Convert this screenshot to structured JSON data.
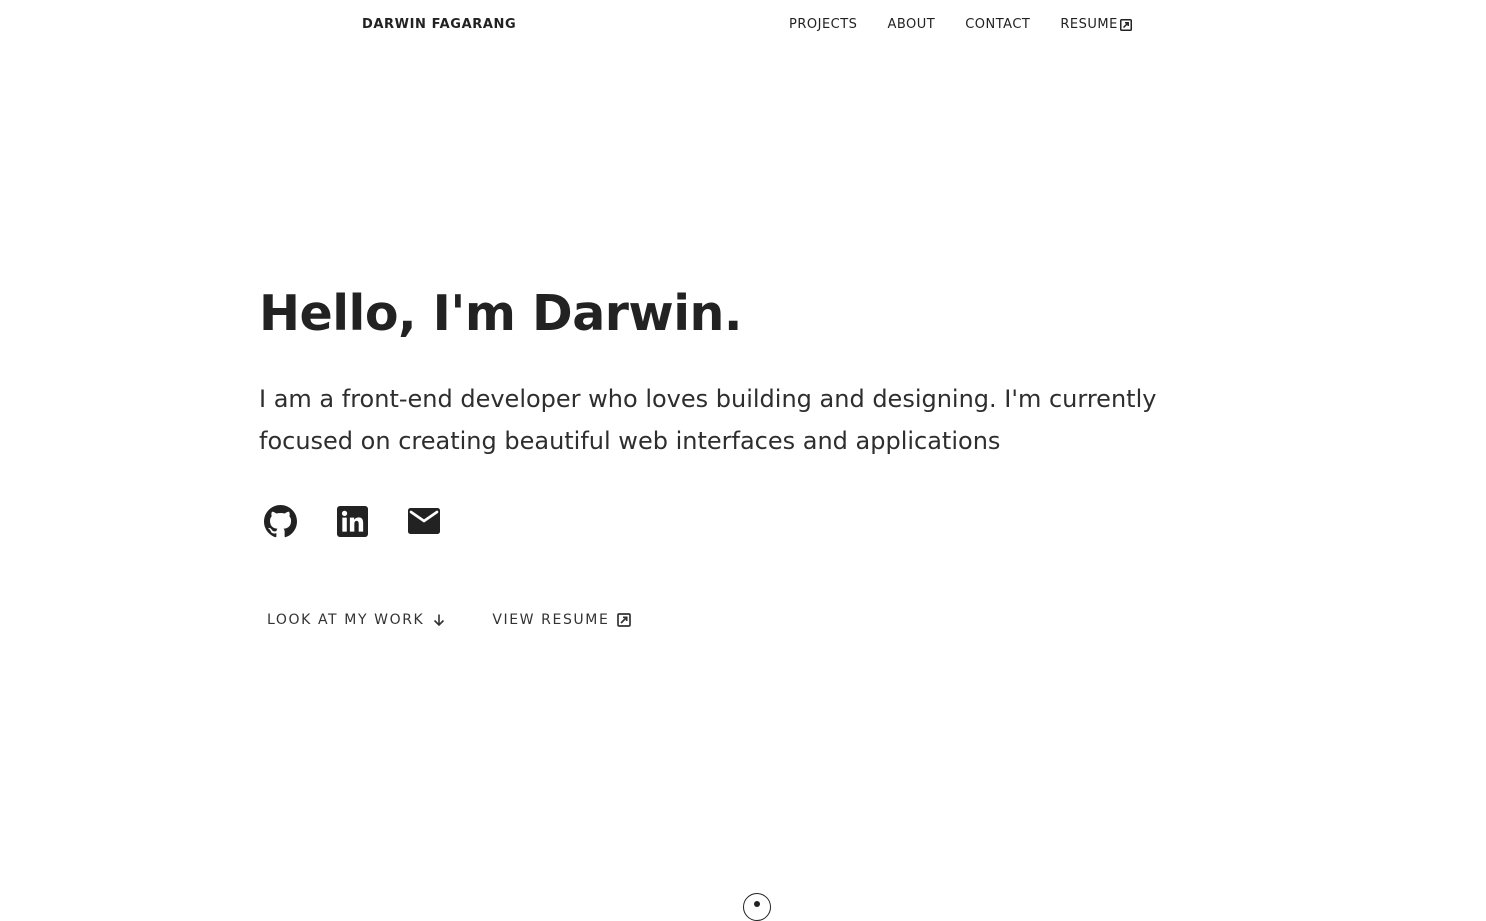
{
  "nav": {
    "brand": "DARWIN FAGARANG",
    "links": [
      {
        "label": "PROJECTS"
      },
      {
        "label": "ABOUT"
      },
      {
        "label": "CONTACT"
      },
      {
        "label": "RESUME"
      }
    ]
  },
  "hero": {
    "title": "Hello, I'm Darwin.",
    "description": "I am a front-end developer who loves building and designing. I'm currently focused on creating beautiful web interfaces and applications"
  },
  "socials": [
    {
      "icon": "github-icon"
    },
    {
      "icon": "linkedin-icon"
    },
    {
      "icon": "mail-icon"
    }
  ],
  "actions": {
    "work_label": "LOOK AT MY WORK",
    "resume_label": "VIEW RESUME"
  },
  "colors": {
    "text": "#222222",
    "background": "#ffffff"
  }
}
